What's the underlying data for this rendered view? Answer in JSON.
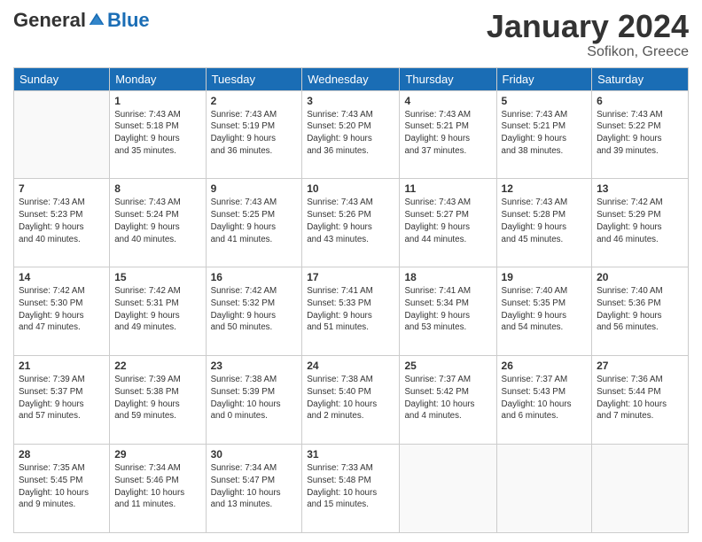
{
  "logo": {
    "general": "General",
    "blue": "Blue"
  },
  "title": "January 2024",
  "location": "Sofikon, Greece",
  "days_header": [
    "Sunday",
    "Monday",
    "Tuesday",
    "Wednesday",
    "Thursday",
    "Friday",
    "Saturday"
  ],
  "weeks": [
    [
      {
        "day": "",
        "info": ""
      },
      {
        "day": "1",
        "info": "Sunrise: 7:43 AM\nSunset: 5:18 PM\nDaylight: 9 hours\nand 35 minutes."
      },
      {
        "day": "2",
        "info": "Sunrise: 7:43 AM\nSunset: 5:19 PM\nDaylight: 9 hours\nand 36 minutes."
      },
      {
        "day": "3",
        "info": "Sunrise: 7:43 AM\nSunset: 5:20 PM\nDaylight: 9 hours\nand 36 minutes."
      },
      {
        "day": "4",
        "info": "Sunrise: 7:43 AM\nSunset: 5:21 PM\nDaylight: 9 hours\nand 37 minutes."
      },
      {
        "day": "5",
        "info": "Sunrise: 7:43 AM\nSunset: 5:21 PM\nDaylight: 9 hours\nand 38 minutes."
      },
      {
        "day": "6",
        "info": "Sunrise: 7:43 AM\nSunset: 5:22 PM\nDaylight: 9 hours\nand 39 minutes."
      }
    ],
    [
      {
        "day": "7",
        "info": "Sunrise: 7:43 AM\nSunset: 5:23 PM\nDaylight: 9 hours\nand 40 minutes."
      },
      {
        "day": "8",
        "info": "Sunrise: 7:43 AM\nSunset: 5:24 PM\nDaylight: 9 hours\nand 40 minutes."
      },
      {
        "day": "9",
        "info": "Sunrise: 7:43 AM\nSunset: 5:25 PM\nDaylight: 9 hours\nand 41 minutes."
      },
      {
        "day": "10",
        "info": "Sunrise: 7:43 AM\nSunset: 5:26 PM\nDaylight: 9 hours\nand 43 minutes."
      },
      {
        "day": "11",
        "info": "Sunrise: 7:43 AM\nSunset: 5:27 PM\nDaylight: 9 hours\nand 44 minutes."
      },
      {
        "day": "12",
        "info": "Sunrise: 7:43 AM\nSunset: 5:28 PM\nDaylight: 9 hours\nand 45 minutes."
      },
      {
        "day": "13",
        "info": "Sunrise: 7:42 AM\nSunset: 5:29 PM\nDaylight: 9 hours\nand 46 minutes."
      }
    ],
    [
      {
        "day": "14",
        "info": "Sunrise: 7:42 AM\nSunset: 5:30 PM\nDaylight: 9 hours\nand 47 minutes."
      },
      {
        "day": "15",
        "info": "Sunrise: 7:42 AM\nSunset: 5:31 PM\nDaylight: 9 hours\nand 49 minutes."
      },
      {
        "day": "16",
        "info": "Sunrise: 7:42 AM\nSunset: 5:32 PM\nDaylight: 9 hours\nand 50 minutes."
      },
      {
        "day": "17",
        "info": "Sunrise: 7:41 AM\nSunset: 5:33 PM\nDaylight: 9 hours\nand 51 minutes."
      },
      {
        "day": "18",
        "info": "Sunrise: 7:41 AM\nSunset: 5:34 PM\nDaylight: 9 hours\nand 53 minutes."
      },
      {
        "day": "19",
        "info": "Sunrise: 7:40 AM\nSunset: 5:35 PM\nDaylight: 9 hours\nand 54 minutes."
      },
      {
        "day": "20",
        "info": "Sunrise: 7:40 AM\nSunset: 5:36 PM\nDaylight: 9 hours\nand 56 minutes."
      }
    ],
    [
      {
        "day": "21",
        "info": "Sunrise: 7:39 AM\nSunset: 5:37 PM\nDaylight: 9 hours\nand 57 minutes."
      },
      {
        "day": "22",
        "info": "Sunrise: 7:39 AM\nSunset: 5:38 PM\nDaylight: 9 hours\nand 59 minutes."
      },
      {
        "day": "23",
        "info": "Sunrise: 7:38 AM\nSunset: 5:39 PM\nDaylight: 10 hours\nand 0 minutes."
      },
      {
        "day": "24",
        "info": "Sunrise: 7:38 AM\nSunset: 5:40 PM\nDaylight: 10 hours\nand 2 minutes."
      },
      {
        "day": "25",
        "info": "Sunrise: 7:37 AM\nSunset: 5:42 PM\nDaylight: 10 hours\nand 4 minutes."
      },
      {
        "day": "26",
        "info": "Sunrise: 7:37 AM\nSunset: 5:43 PM\nDaylight: 10 hours\nand 6 minutes."
      },
      {
        "day": "27",
        "info": "Sunrise: 7:36 AM\nSunset: 5:44 PM\nDaylight: 10 hours\nand 7 minutes."
      }
    ],
    [
      {
        "day": "28",
        "info": "Sunrise: 7:35 AM\nSunset: 5:45 PM\nDaylight: 10 hours\nand 9 minutes."
      },
      {
        "day": "29",
        "info": "Sunrise: 7:34 AM\nSunset: 5:46 PM\nDaylight: 10 hours\nand 11 minutes."
      },
      {
        "day": "30",
        "info": "Sunrise: 7:34 AM\nSunset: 5:47 PM\nDaylight: 10 hours\nand 13 minutes."
      },
      {
        "day": "31",
        "info": "Sunrise: 7:33 AM\nSunset: 5:48 PM\nDaylight: 10 hours\nand 15 minutes."
      },
      {
        "day": "",
        "info": ""
      },
      {
        "day": "",
        "info": ""
      },
      {
        "day": "",
        "info": ""
      }
    ]
  ]
}
